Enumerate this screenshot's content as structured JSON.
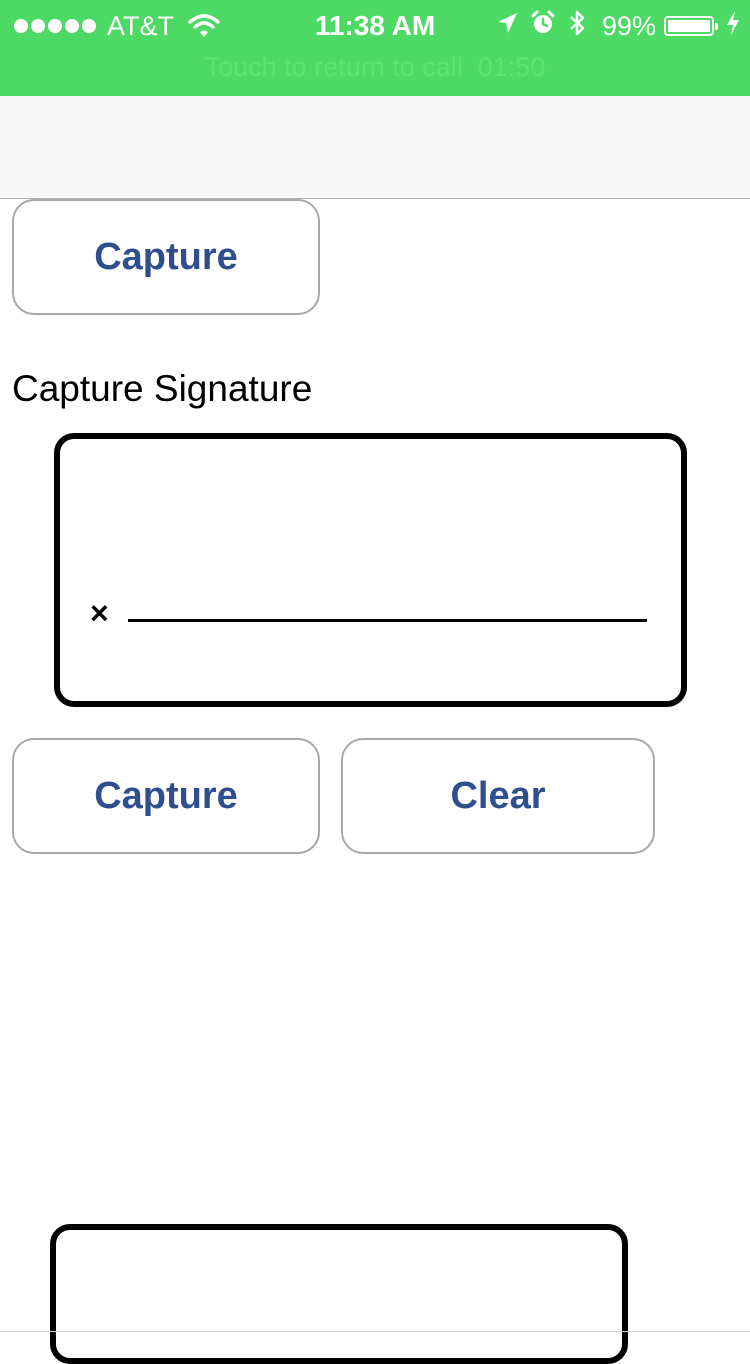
{
  "status_bar": {
    "carrier": "AT&T",
    "time": "11:38 AM",
    "battery_percent": "99%",
    "battery_level": 0.99,
    "signal_dots": 5,
    "call_banner": "Touch to return to call  01:50",
    "background_color": "#4cd964",
    "icons": [
      "wifi-icon",
      "location-arrow-icon",
      "alarm-clock-icon",
      "bluetooth-icon",
      "battery-icon",
      "charging-bolt-icon"
    ]
  },
  "main": {
    "top_button_label": "Capture",
    "signature_title": "Capture Signature",
    "signature_x_mark": "×",
    "capture_button_label": "Capture",
    "clear_button_label": "Clear",
    "button_text_color": "#2f4e8e"
  }
}
